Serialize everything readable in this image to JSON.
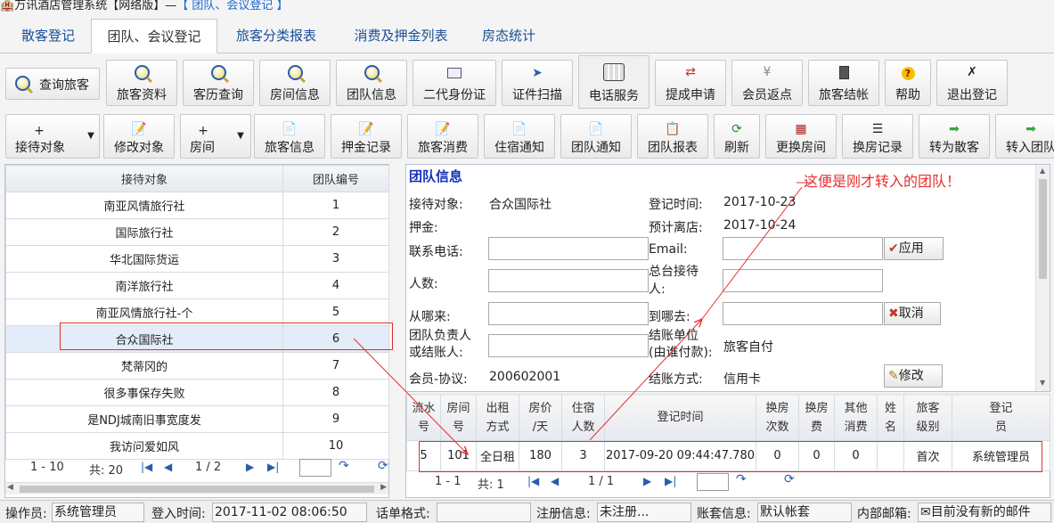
{
  "title": {
    "app": "万讯酒店管理系统【网络版】—",
    "section": "【 团队、会议登记 】"
  },
  "tabs": [
    "散客登记",
    "团队、会议登记",
    "旅客分类报表",
    "消费及押金列表",
    "房态统计"
  ],
  "toolbar1": {
    "query_guest": "查询旅客",
    "buttons": [
      "旅客资料",
      "客历查询",
      "房间信息",
      "团队信息",
      "二代身份证",
      "证件扫描",
      "电话服务",
      "提成申请",
      "会员返点",
      "旅客结帐",
      "帮助",
      "退出登记"
    ]
  },
  "toolbar2": [
    "接待对象",
    "修改对象",
    "房间",
    "旅客信息",
    "押金记录",
    "旅客消费",
    "住宿通知",
    "团队通知",
    "团队报表",
    "刷新",
    "更换房间",
    "换房记录",
    "转为散客",
    "转入团队"
  ],
  "left_table": {
    "headers": [
      "接待对象",
      "团队编号"
    ],
    "rows": [
      [
        "南亚风情旅行社",
        "1"
      ],
      [
        "国际旅行社",
        "2"
      ],
      [
        "华北国际货运",
        "3"
      ],
      [
        "南洋旅行社",
        "4"
      ],
      [
        "南亚风情旅行社-个",
        "5"
      ],
      [
        "合众国际社",
        "6"
      ],
      [
        "梵蒂冈的",
        "7"
      ],
      [
        "很多事保存失败",
        "8"
      ],
      [
        "是NDJ城南旧事宽度发",
        "9"
      ],
      [
        "我访问爱如风",
        "10"
      ]
    ],
    "selected_index": 5,
    "pager": {
      "range": "1 - 10",
      "total": "共: 20",
      "page": "1 / 2",
      "page_input": ""
    }
  },
  "team_info": {
    "heading": "团队信息",
    "reception_label": "接待对象:",
    "reception_value": "合众国际社",
    "checkin_label": "登记时间:",
    "checkin_value": "2017-10-23",
    "deposit_label": "押金:",
    "depart_label": "预计离店:",
    "depart_value": "2017-10-24",
    "phone_label": "联系电话:",
    "email_label": "Email:",
    "people_label": "人数:",
    "front_label_1": "总台接待",
    "front_label_2": "人:",
    "from_label": "从哪来:",
    "to_label": "到哪去:",
    "leader_label_1": "团队负责人",
    "leader_label_2": "或结账人:",
    "pay_unit_label_1": "结账单位",
    "pay_unit_label_2": "(由谁付款):",
    "pay_unit_value": "旅客自付",
    "member_label": "会员-协议:",
    "member_value": "200602001",
    "pay_method_label": "结账方式:",
    "pay_method_value": "信用卡",
    "apply_btn": "应用",
    "cancel_btn": "取消",
    "modify_btn": "修改"
  },
  "annotation": "这便是刚才转入的团队！",
  "room_table": {
    "headers": [
      "流水号",
      "房间号",
      "出租方式",
      "房价/天",
      "住宿人数",
      "登记时间",
      "换房次数",
      "换房费",
      "其他消费",
      "姓名",
      "旅客级别",
      "登记员"
    ],
    "rows": [
      [
        "5",
        "101",
        "全日租",
        "180",
        "3",
        "2017-09-20 09:44:47.780",
        "0",
        "0",
        "0",
        "",
        "首次",
        "系统管理员"
      ]
    ],
    "pager": {
      "range": "1 - 1",
      "total": "共: 1",
      "page": "1 / 1",
      "page_input": ""
    }
  },
  "status_bar": {
    "operator_label": "操作员:",
    "operator_value": "系统管理员",
    "login_label": "登入时间:",
    "login_value": "2017-11-02 08:06:50",
    "sms_label": "话单格式:",
    "sms_value": "",
    "reg_label": "注册信息:",
    "reg_value": "未注册...",
    "account_label": "账套信息:",
    "account_value": "默认帐套",
    "mail_label": "内部邮箱:",
    "mail_value": "目前没有新的邮件"
  },
  "colors": {
    "accent": "#1a6bd6",
    "annotation": "#e53030",
    "highlight": "#d9342b",
    "selected_row": "#e3ecf8"
  }
}
